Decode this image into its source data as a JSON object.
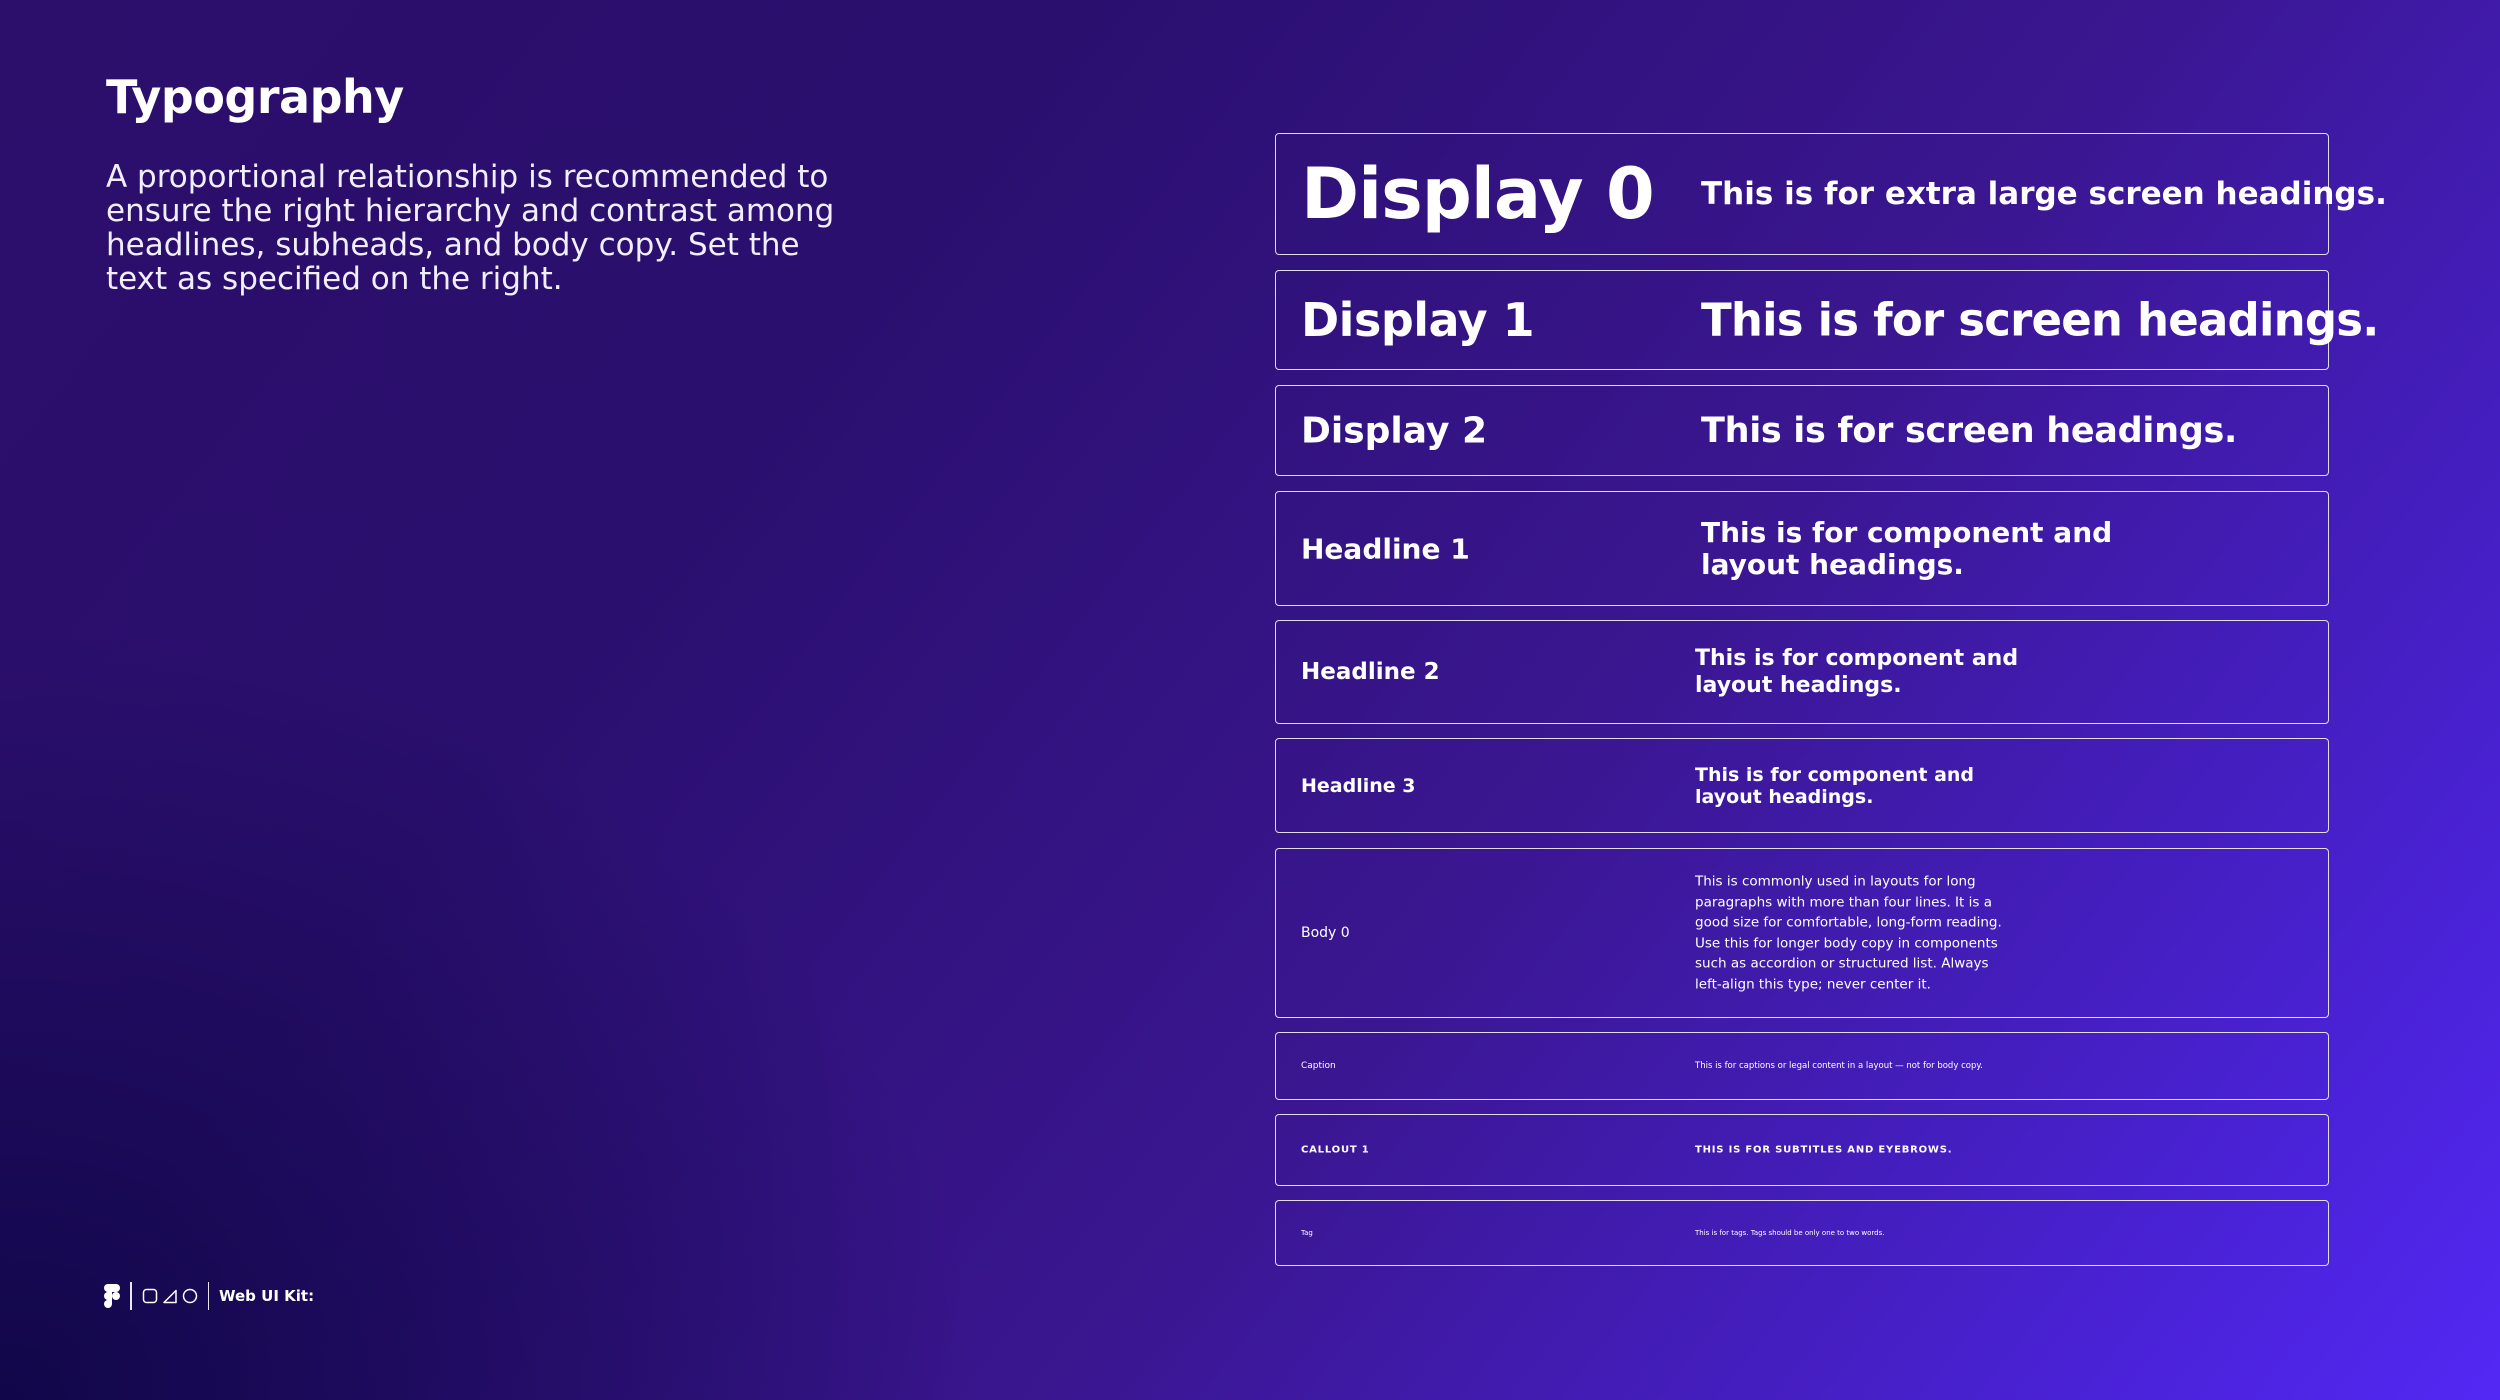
{
  "header": {
    "title": "Typography",
    "intro": "A proportional relationship is recommended to ensure the right hierarchy and contrast among headlines, subheads, and body copy. Set the text as specified on the right."
  },
  "styles": [
    {
      "name": "Display 0",
      "description": "This is for extra large screen headings."
    },
    {
      "name": "Display 1",
      "description": "This is for screen headings."
    },
    {
      "name": "Display 2",
      "description": "This is for screen headings."
    },
    {
      "name": "Headline 1",
      "description": "This is for component and layout headings."
    },
    {
      "name": "Headline 2",
      "description": "This is for component and layout headings."
    },
    {
      "name": "Headline 3",
      "description": "This is for component and layout headings."
    },
    {
      "name": "Body 0",
      "description": "This is commonly used in layouts for long paragraphs with more than four lines. It is a good size for comfortable, long-form reading. Use this for longer body copy in components such as accordion or structured list. Always left-align this type; never center it."
    },
    {
      "name": "Caption",
      "description": "This is for captions or legal content in a layout — not for body copy."
    },
    {
      "name": "CALLOUT 1",
      "description": "THIS IS FOR SUBTITLES AND EYEBROWS."
    },
    {
      "name": "Tag",
      "description": "This is for tags. Tags should be only one to two words."
    }
  ],
  "footer": {
    "logo_icon": "figma-logo-icon",
    "shape_icons": [
      "square-icon",
      "triangle-icon",
      "circle-icon"
    ],
    "label": "Web UI Kit:"
  },
  "colors": {
    "background_start": "#2a0f6e",
    "background_end": "#5328f4",
    "text": "#ffffff"
  }
}
